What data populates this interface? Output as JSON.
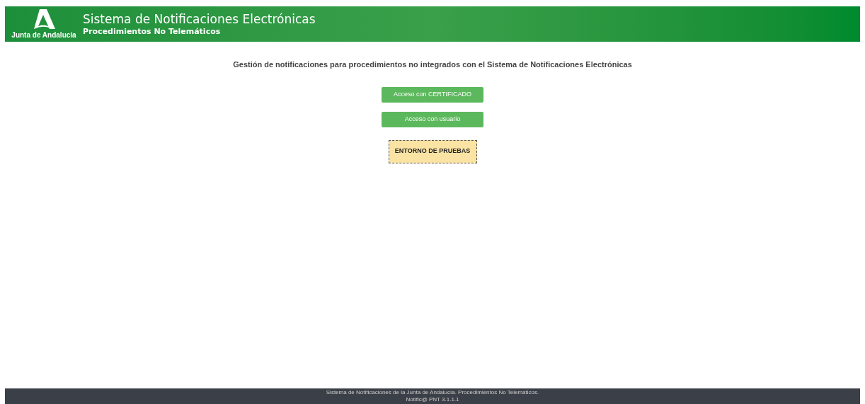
{
  "header": {
    "logo_text": "Junta de Andalucía",
    "title": "Sistema de Notificaciones Electrónicas",
    "subtitle": "Procedimientos No Telemáticos"
  },
  "intro": "Gestión de notificaciones para procedimientos no integrados con el Sistema de Notificaciones Electrónicas",
  "buttons": [
    "Acceso con CERTIFICADO",
    "Acceso con usuario"
  ],
  "environment_badge": "ENTORNO DE PRUEBAS",
  "footer": [
    "Sistema de Notificaciones de la Junta de Andalucía. Procedimientos No Telemáticos.",
    "Notific@ PNT 3.1.1.1"
  ]
}
